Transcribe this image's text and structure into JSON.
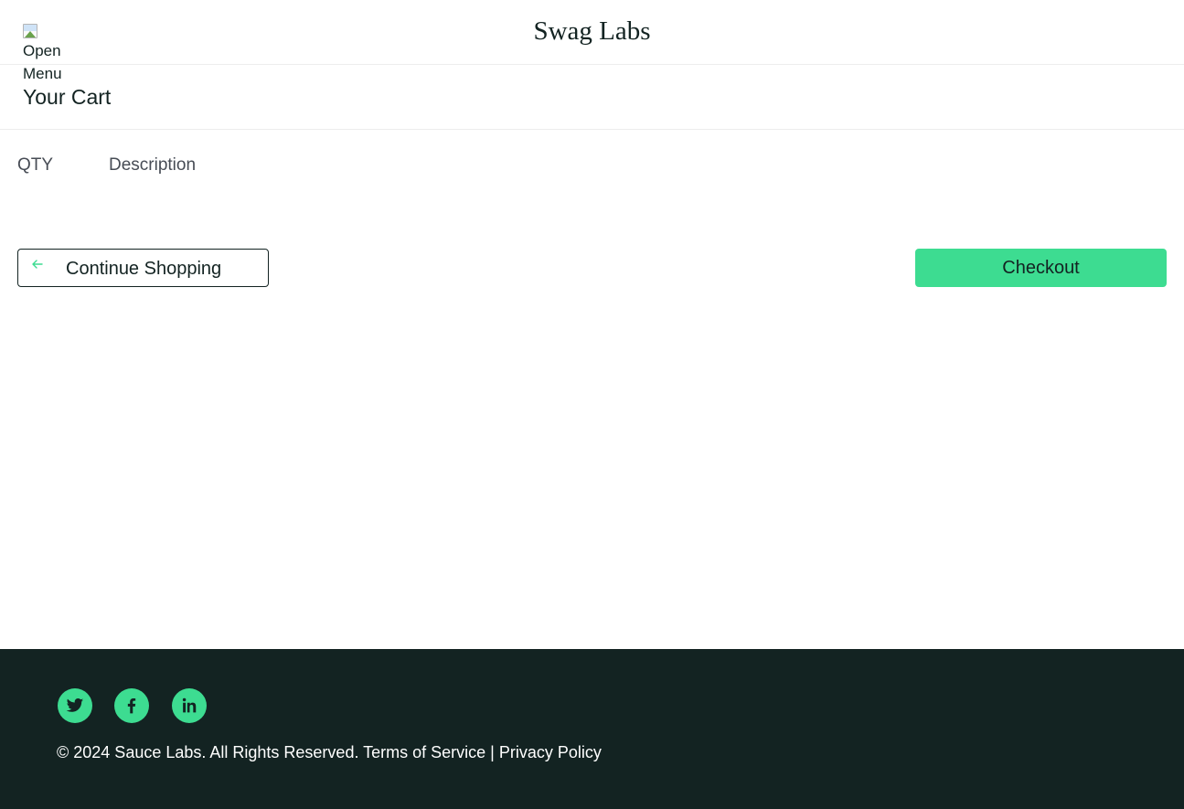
{
  "header": {
    "menu_label": "Open Menu",
    "menu_line1": "Open",
    "menu_line2": "Menu",
    "brand": "Swag Labs"
  },
  "page": {
    "title": "Your Cart"
  },
  "cart": {
    "columns": [
      "QTY",
      "Description"
    ],
    "items": []
  },
  "actions": {
    "continue_label": "Continue Shopping",
    "checkout_label": "Checkout"
  },
  "footer": {
    "social": [
      "twitter-icon",
      "facebook-icon",
      "linkedin-icon"
    ],
    "copyright": "© 2024 Sauce Labs. All Rights Reserved. Terms of Service | Privacy Policy"
  },
  "colors": {
    "accent": "#3ddc91",
    "dark": "#132322",
    "border": "#ededed"
  }
}
